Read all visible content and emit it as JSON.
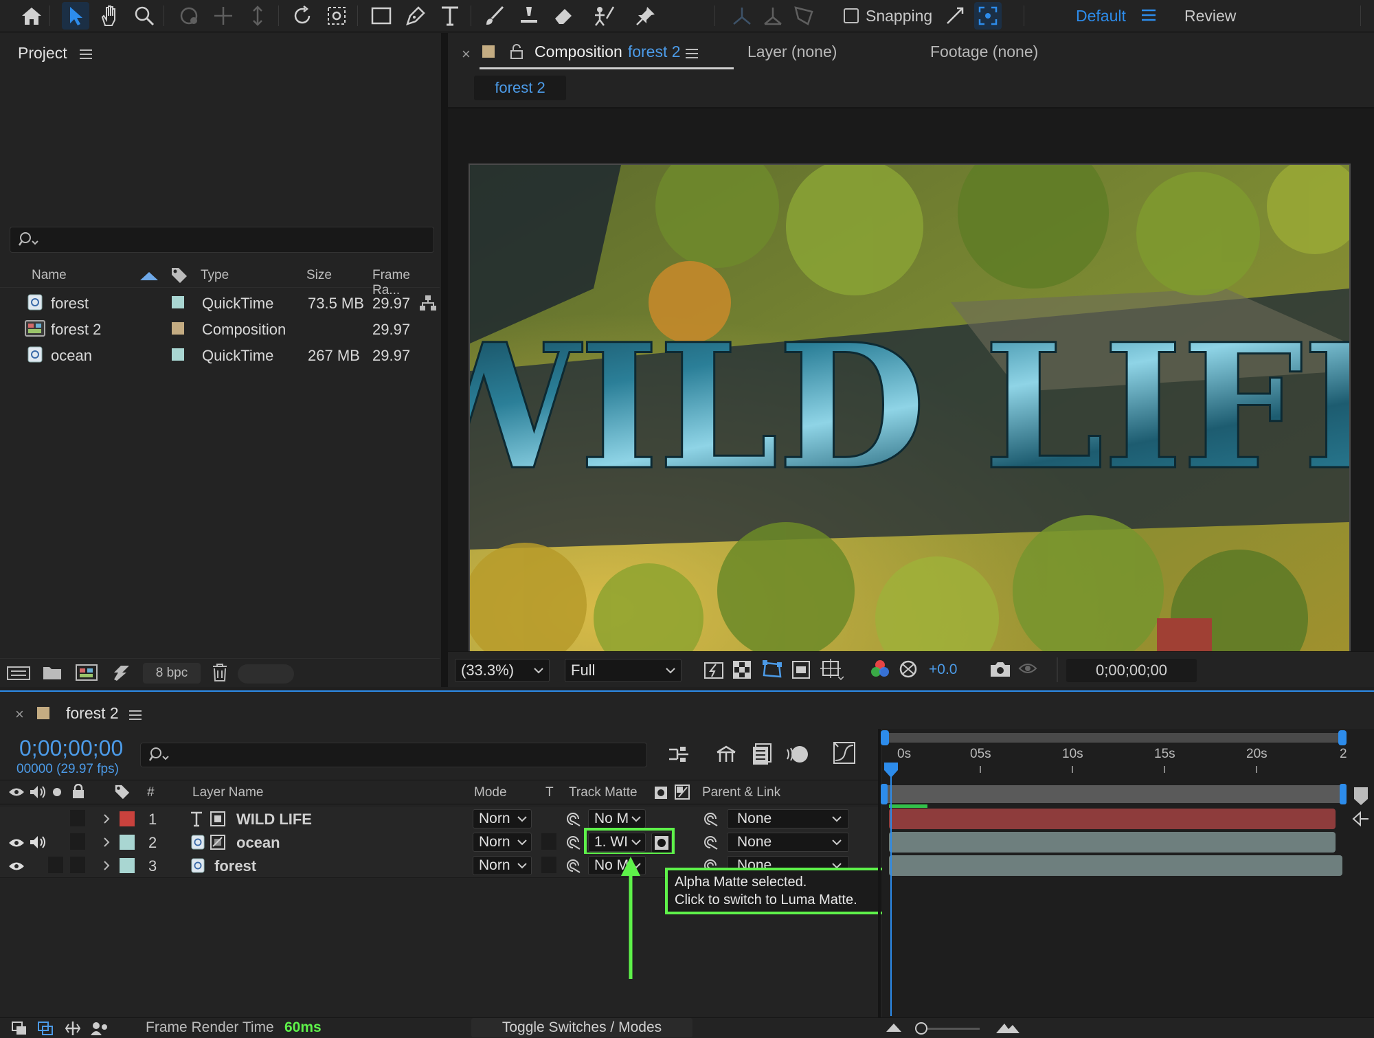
{
  "toolbar": {
    "snapping_label": "Snapping",
    "workspace_default": "Default",
    "workspace_review": "Review"
  },
  "project": {
    "title": "Project",
    "search_placeholder": "",
    "columns": {
      "name": "Name",
      "type": "Type",
      "size": "Size",
      "frame_rate": "Frame Ra..."
    },
    "items": [
      {
        "name": "forest",
        "type": "QuickTime",
        "size": "73.5 MB",
        "frame_rate": "29.97",
        "label_color": "#a9d6d2",
        "icon": "footage-icon"
      },
      {
        "name": "forest 2",
        "type": "Composition",
        "size": "",
        "frame_rate": "29.97",
        "label_color": "#c4ac82",
        "icon": "composition-icon"
      },
      {
        "name": "ocean",
        "type": "QuickTime",
        "size": "267 MB",
        "frame_rate": "29.97",
        "label_color": "#a9d6d2",
        "icon": "footage-icon"
      }
    ],
    "bpc": "8 bpc"
  },
  "viewer": {
    "tab_prefix": "Composition",
    "tab_comp": "forest 2",
    "tab_layer": "Layer (none)",
    "tab_footage": "Footage (none)",
    "breadcrumb": "forest 2",
    "overlay_text": "WILD LIFE",
    "zoom": "(33.3%)",
    "resolution": "Full",
    "exposure": "+0.0",
    "timecode": "0;00;00;00"
  },
  "timeline": {
    "comp_name": "forest 2",
    "timecode": "0;00;00;00",
    "frame_info": "00000 (29.97 fps)",
    "search_placeholder": "",
    "columns": {
      "num": "#",
      "layer_name": "Layer Name",
      "mode": "Mode",
      "t": "T",
      "track_matte": "Track Matte",
      "parent": "Parent & Link"
    },
    "layers": [
      {
        "num": "1",
        "name": "WILD LIFE",
        "mode": "Norn",
        "track_matte": "No M",
        "parent": "None",
        "label_color": "#c9423d",
        "bar_color": "#8e3c3c"
      },
      {
        "num": "2",
        "name": "ocean",
        "mode": "Norn",
        "track_matte": "1. WI",
        "parent": "None",
        "label_color": "#a9d6d2",
        "bar_color": "#6e7f7e"
      },
      {
        "num": "3",
        "name": "forest",
        "mode": "Norn",
        "track_matte": "No M",
        "parent": "None",
        "label_color": "#a9d6d2",
        "bar_color": "#6e7f7e"
      }
    ],
    "ruler": [
      "0s",
      "05s",
      "10s",
      "15s",
      "20s",
      "2"
    ],
    "tooltip_line1": "Alpha Matte selected.",
    "tooltip_line2": "Click to switch to Luma Matte.",
    "frame_render_label": "Frame Render Time",
    "frame_render_value": "60ms",
    "toggle_label": "Toggle Switches / Modes",
    "highlight_color": "#5ef24a",
    "accent_color": "#2d8ceb"
  }
}
